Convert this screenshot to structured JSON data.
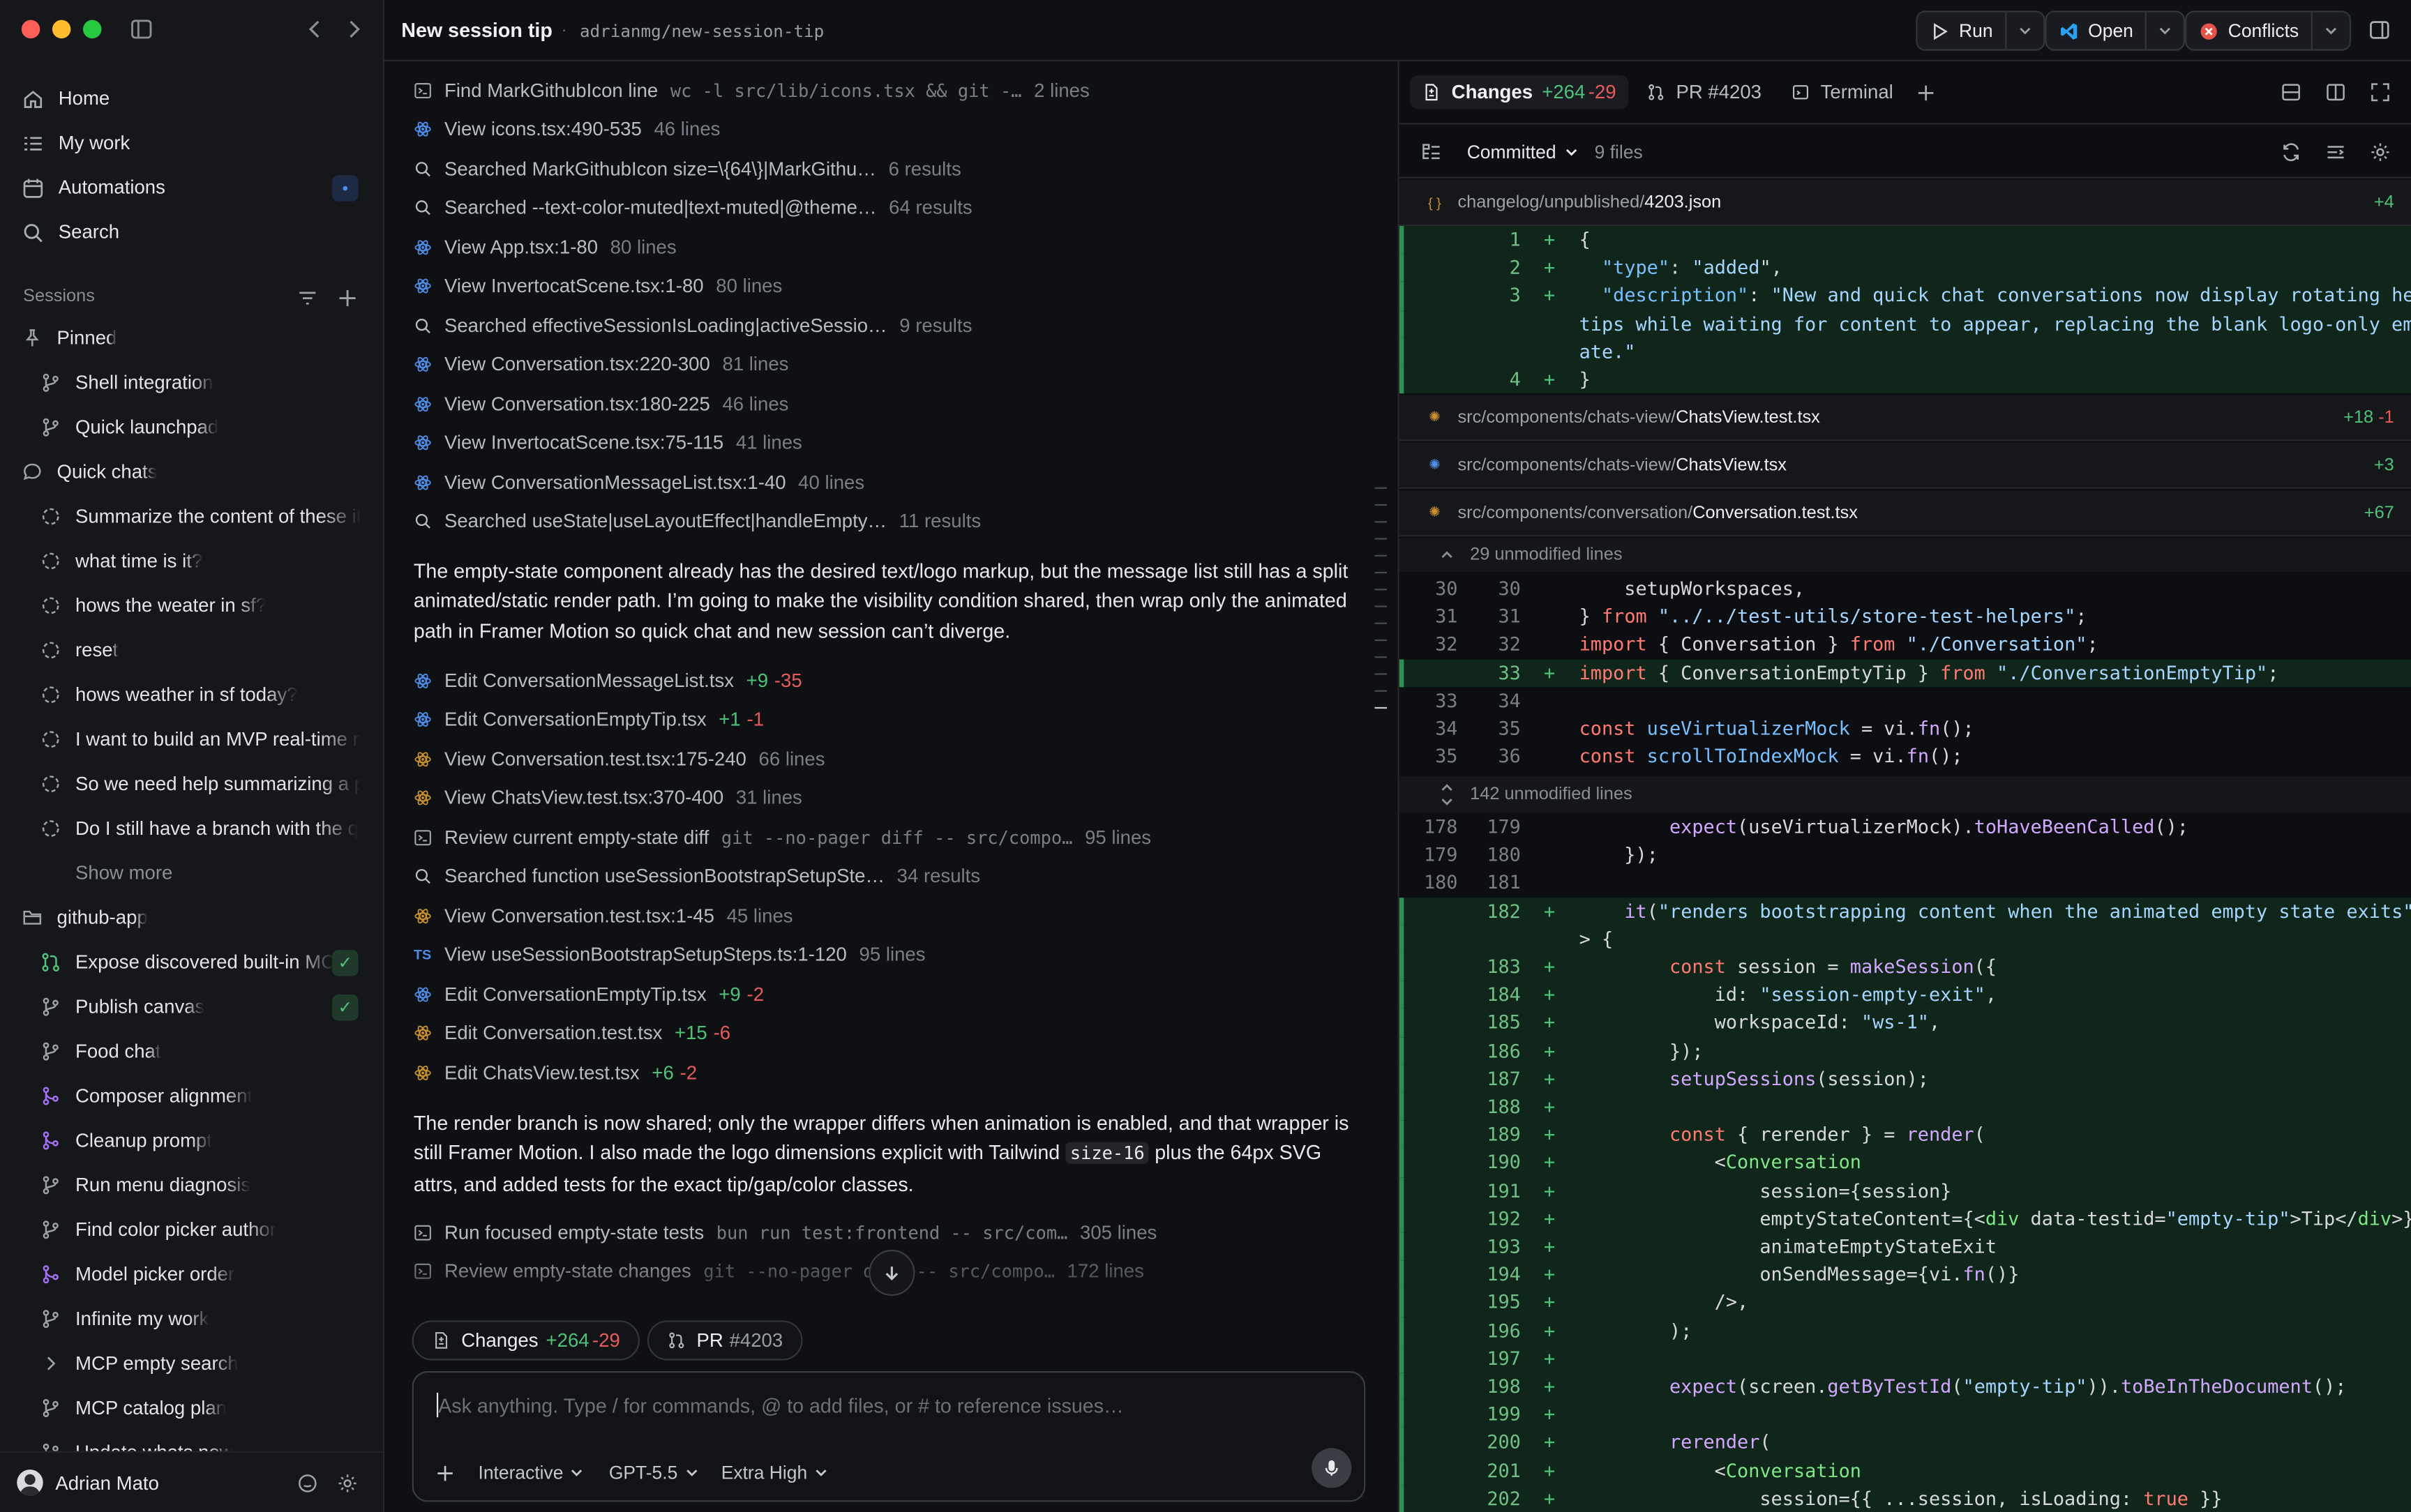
{
  "window": {
    "title": "New session tip",
    "branch": "adrianmg/new-session-tip"
  },
  "toolbar_buttons": {
    "run": "Run",
    "open": "Open",
    "conflicts": "Conflicts"
  },
  "sidebar": {
    "nav": [
      {
        "label": "Home",
        "icon": "home-icon"
      },
      {
        "label": "My work",
        "icon": "list-icon"
      },
      {
        "label": "Automations",
        "icon": "calendar-icon"
      },
      {
        "label": "Search",
        "icon": "search-icon"
      }
    ],
    "sessions_title": "Sessions",
    "pinned_label": "Pinned",
    "pinned": [
      "Shell integration",
      "Quick launchpad"
    ],
    "quick_chats_label": "Quick chats",
    "quick_chats": [
      "Summarize the content of these it",
      "what time is it?",
      "hows the weater in sf?",
      "reset",
      "hows weather in sf today?",
      "I want to build an MVP real-time n",
      "So we need help summarizing a p",
      "Do I still have a branch with the q"
    ],
    "show_more": "Show more",
    "repo_label": "github-app",
    "repo_items": [
      {
        "label": "Expose discovered built-in MC",
        "icon": "pull-request-icon",
        "checked": true
      },
      {
        "label": "Publish canvas",
        "icon": "branch-icon",
        "checked": true
      },
      {
        "label": "Food chat",
        "icon": "branch-icon",
        "checked": false
      },
      {
        "label": "Composer alignment",
        "icon": "merged-icon",
        "checked": false
      },
      {
        "label": "Cleanup prompt",
        "icon": "merged-icon",
        "checked": false
      },
      {
        "label": "Run menu diagnosis",
        "icon": "branch-icon",
        "checked": false
      },
      {
        "label": "Find color picker author",
        "icon": "branch-icon",
        "checked": false
      },
      {
        "label": "Model picker order",
        "icon": "merged-icon",
        "checked": false
      },
      {
        "label": "Infinite my work",
        "icon": "branch-icon",
        "checked": false
      },
      {
        "label": "MCP empty search",
        "icon": "chevron-right-icon",
        "checked": false
      },
      {
        "label": "MCP catalog plan",
        "icon": "branch-icon",
        "checked": false
      },
      {
        "label": "Update whats new",
        "icon": "branch-icon",
        "checked": false
      }
    ],
    "user_name": "Adrian Mato"
  },
  "chat": {
    "actions_top": [
      {
        "icon": "terminal-icon",
        "label": "Find MarkGithubIcon line",
        "cmd": "wc -l src/lib/icons.tsx && git -…",
        "meta": "2 lines"
      },
      {
        "icon": "react-icon",
        "label": "View icons.tsx:490-535",
        "meta": "46 lines"
      },
      {
        "icon": "search-icon",
        "label": "Searched MarkGithubIcon size=\\{64\\}|MarkGithu…",
        "meta": "6 results"
      },
      {
        "icon": "search-icon",
        "label": "Searched --text-color-muted|text-muted|@theme…",
        "meta": "64 results"
      },
      {
        "icon": "react-icon",
        "label": "View App.tsx:1-80",
        "meta": "80 lines"
      },
      {
        "icon": "react-icon",
        "label": "View InvertocatScene.tsx:1-80",
        "meta": "80 lines"
      },
      {
        "icon": "search-icon",
        "label": "Searched effectiveSessionIsLoading|activeSessio…",
        "meta": "9 results"
      },
      {
        "icon": "react-icon",
        "label": "View Conversation.tsx:220-300",
        "meta": "81 lines"
      },
      {
        "icon": "react-icon",
        "label": "View Conversation.tsx:180-225",
        "meta": "46 lines"
      },
      {
        "icon": "react-icon",
        "label": "View InvertocatScene.tsx:75-115",
        "meta": "41 lines"
      },
      {
        "icon": "react-icon",
        "label": "View ConversationMessageList.tsx:1-40",
        "meta": "40 lines"
      },
      {
        "icon": "search-icon",
        "label": "Searched useState|useLayoutEffect|handleEmpty…",
        "meta": "11 results"
      }
    ],
    "paragraph_1": "The empty-state component already has the desired text/logo markup, but the message list still has a split animated/static render path. I’m going to make the visibility condition shared, then wrap only the animated path in Framer Motion so quick chat and new session can’t diverge.",
    "actions_mid": [
      {
        "icon": "react-icon",
        "label": "Edit ConversationMessageList.tsx",
        "add": "+9",
        "del": "-35"
      },
      {
        "icon": "react-icon",
        "label": "Edit ConversationEmptyTip.tsx",
        "add": "+1",
        "del": "-1"
      },
      {
        "icon": "test-icon",
        "label": "View Conversation.test.tsx:175-240",
        "meta": "66 lines"
      },
      {
        "icon": "test-icon",
        "label": "View ChatsView.test.tsx:370-400",
        "meta": "31 lines"
      },
      {
        "icon": "terminal-icon",
        "label": "Review current empty-state diff",
        "cmd": "git --no-pager diff -- src/compo…",
        "meta": "95 lines"
      },
      {
        "icon": "search-icon",
        "label": "Searched function useSessionBootstrapSetupSte…",
        "meta": "34 results"
      },
      {
        "icon": "test-icon",
        "label": "View Conversation.test.tsx:1-45",
        "meta": "45 lines"
      },
      {
        "icon": "ts-icon",
        "label": "View useSessionBootstrapSetupSteps.ts:1-120",
        "meta": "95 lines"
      },
      {
        "icon": "react-icon",
        "label": "Edit ConversationEmptyTip.tsx",
        "add": "+9",
        "del": "-2"
      },
      {
        "icon": "test-icon",
        "label": "Edit Conversation.test.tsx",
        "add": "+15",
        "del": "-6"
      },
      {
        "icon": "test-icon",
        "label": "Edit ChatsView.test.tsx",
        "add": "+6",
        "del": "-2"
      }
    ],
    "paragraph_2a": "The render branch is now shared; only the wrapper differs when animation is enabled, and that wrapper is still Framer Motion. I also made the logo dimensions explicit with Tailwind ",
    "paragraph_2_code": "size-16",
    "paragraph_2b": " plus the 64px SVG attrs, and added tests for the exact tip/gap/color classes.",
    "actions_bottom": [
      {
        "icon": "terminal-icon",
        "label": "Run focused empty-state tests",
        "cmd": "bun run test:frontend -- src/com…",
        "meta": "305 lines"
      },
      {
        "icon": "terminal-icon",
        "label": "Review empty-state changes",
        "cmd": "git --no-pager diff -- src/compo…",
        "meta": "172 lines"
      }
    ],
    "chip_changes": "Changes",
    "chip_changes_add": "+264",
    "chip_changes_del": "-29",
    "chip_pr": "PR",
    "chip_pr_num": "#4203",
    "composer_placeholder": "Ask anything. Type / for commands, @ to add files, or # to reference issues…",
    "mode": "Interactive",
    "model": "GPT-5.5",
    "effort": "Extra High"
  },
  "diff": {
    "tabs": {
      "changes": "Changes",
      "changes_add": "+264",
      "changes_del": "-29",
      "pr": "PR #4203",
      "terminal": "Terminal"
    },
    "filter": "Committed",
    "file_count": "9 files",
    "files": [
      {
        "dir": "changelog/unpublished/",
        "name": "4203.json",
        "stat_add": "+4",
        "stat_del": ""
      },
      {
        "dir": "src/components/chats-view/",
        "name": "ChatsView.test.tsx",
        "stat_add": "+18",
        "stat_del": "-1"
      },
      {
        "dir": "src/components/chats-view/",
        "name": "ChatsView.tsx",
        "stat_add": "+3",
        "stat_del": ""
      },
      {
        "dir": "src/components/conversation/",
        "name": "Conversation.test.tsx",
        "stat_add": "+67",
        "stat_del": ""
      }
    ],
    "json_lines": [
      {
        "n": "1",
        "code": "{"
      },
      {
        "n": "2",
        "code": "  \"type\": \"added\","
      },
      {
        "n": "3",
        "code": "  \"description\": \"New and quick chat conversations now display rotating helpful"
      },
      {
        "n": "",
        "code": "tips while waiting for content to appear, replacing the blank logo-only empty st"
      },
      {
        "n": "",
        "code": "ate.\""
      },
      {
        "n": "4",
        "code": "}"
      }
    ],
    "hunk_1": "29 unmodified lines",
    "hunk_2": "142 unmodified lines",
    "test_lines_a": [
      {
        "o": "30",
        "n": "30",
        "code": "    setupWorkspaces,"
      },
      {
        "o": "31",
        "n": "31",
        "code": "} from \"../../test-utils/store-test-helpers\";"
      },
      {
        "o": "32",
        "n": "32",
        "code": "import { Conversation } from \"./Conversation\";"
      },
      {
        "o": "",
        "n": "33",
        "add": true,
        "code": "import { ConversationEmptyTip } from \"./ConversationEmptyTip\";"
      },
      {
        "o": "33",
        "n": "34",
        "code": ""
      },
      {
        "o": "34",
        "n": "35",
        "code": "const useVirtualizerMock = vi.fn();"
      },
      {
        "o": "35",
        "n": "36",
        "code": "const scrollToIndexMock = vi.fn();"
      }
    ],
    "test_lines_b": [
      {
        "o": "178",
        "n": "179",
        "code": "        expect(useVirtualizerMock).toHaveBeenCalled();"
      },
      {
        "o": "179",
        "n": "180",
        "code": "    });"
      },
      {
        "o": "180",
        "n": "181",
        "code": ""
      },
      {
        "o": "",
        "n": "182",
        "add": true,
        "code": "    it(\"renders bootstrapping content when the animated empty state exits\", () ="
      },
      {
        "o": "",
        "n": "",
        "add": true,
        "code": "> {"
      },
      {
        "o": "",
        "n": "183",
        "add": true,
        "code": "        const session = makeSession({"
      },
      {
        "o": "",
        "n": "184",
        "add": true,
        "code": "            id: \"session-empty-exit\","
      },
      {
        "o": "",
        "n": "185",
        "add": true,
        "code": "            workspaceId: \"ws-1\","
      },
      {
        "o": "",
        "n": "186",
        "add": true,
        "code": "        });"
      },
      {
        "o": "",
        "n": "187",
        "add": true,
        "code": "        setupSessions(session);"
      },
      {
        "o": "",
        "n": "188",
        "add": true,
        "code": ""
      },
      {
        "o": "",
        "n": "189",
        "add": true,
        "code": "        const { rerender } = render("
      },
      {
        "o": "",
        "n": "190",
        "add": true,
        "code": "            <Conversation"
      },
      {
        "o": "",
        "n": "191",
        "add": true,
        "code": "                session={session}"
      },
      {
        "o": "",
        "n": "192",
        "add": true,
        "code": "                emptyStateContent={<div data-testid=\"empty-tip\">Tip</div>}"
      },
      {
        "o": "",
        "n": "193",
        "add": true,
        "code": "                animateEmptyStateExit"
      },
      {
        "o": "",
        "n": "194",
        "add": true,
        "code": "                onSendMessage={vi.fn()}"
      },
      {
        "o": "",
        "n": "195",
        "add": true,
        "code": "            />,"
      },
      {
        "o": "",
        "n": "196",
        "add": true,
        "code": "        );"
      },
      {
        "o": "",
        "n": "197",
        "add": true,
        "code": ""
      },
      {
        "o": "",
        "n": "198",
        "add": true,
        "code": "        expect(screen.getByTestId(\"empty-tip\")).toBeInTheDocument();"
      },
      {
        "o": "",
        "n": "199",
        "add": true,
        "code": ""
      },
      {
        "o": "",
        "n": "200",
        "add": true,
        "code": "        rerender("
      },
      {
        "o": "",
        "n": "201",
        "add": true,
        "code": "            <Conversation"
      },
      {
        "o": "",
        "n": "202",
        "add": true,
        "code": "                session={{ ...session, isLoading: true }}"
      }
    ]
  }
}
